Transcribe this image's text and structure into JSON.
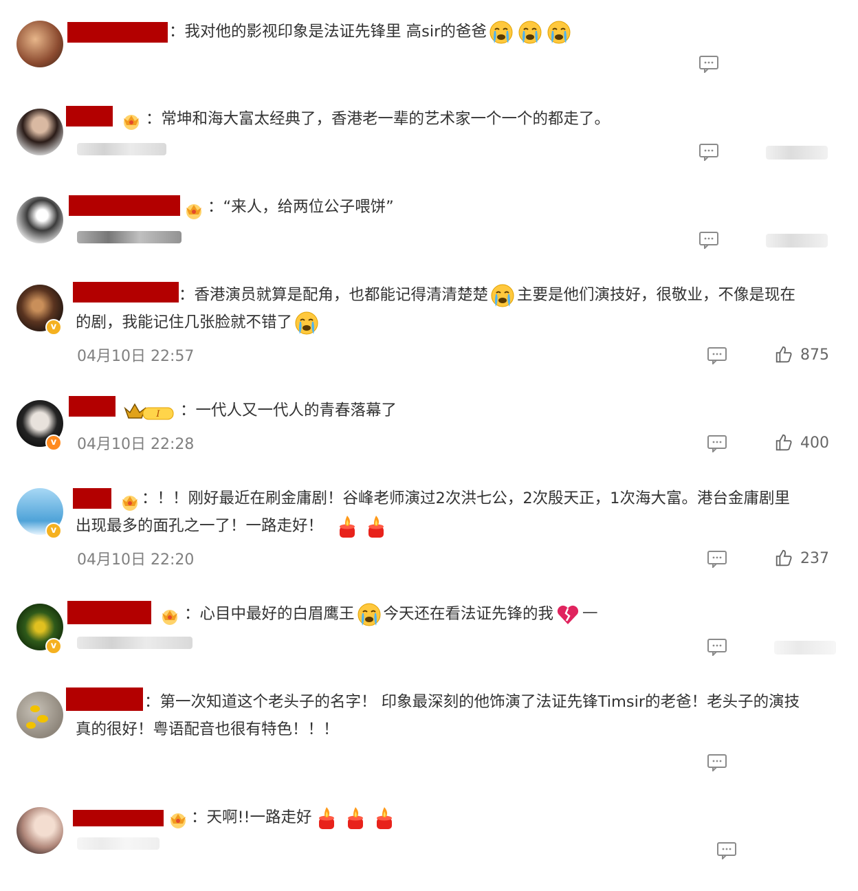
{
  "comments": [
    {
      "text": "：我对他的影视印象是法证先锋里 高sir的爸爸",
      "emojis": 3
    },
    {
      "text": "：常坤和海大富太经典了，香港老一辈的艺术家一个一个的都走了。"
    },
    {
      "text": "：“来人，给两位公子喂饼”"
    },
    {
      "line1": "：香港演员就算是配角，也都能记得清清楚楚",
      "line1b": "主要是他们演技好，很敬业，不像是现在",
      "line2": "的剧，我能记住几张脸就不错了",
      "time": "04月10日 22:57",
      "likes": "875"
    },
    {
      "text": "：一代人又一代人的青春落幕了",
      "time": "04月10日 22:28",
      "likes": "400"
    },
    {
      "line1": "：！！刚好最近在刷金庸剧！谷峰老师演过2次洪七公，2次殷天正，1次海大富。港台金庸剧里",
      "line2": "出现最多的面孔之一了！一路走好！",
      "time": "04月10日 22:20",
      "likes": "237"
    },
    {
      "text": "：心目中最好的白眉鹰王",
      "text_b": "今天还在看法证先锋的我",
      "text_c": "一"
    },
    {
      "line1": "：第一次知道这个老头子的名字！ 印象最深刻的他饰演了法证先锋Timsir的老爸！老头子的演技",
      "line2": "真的很好！粤语配音也很有特色！！！"
    },
    {
      "text": "：天啊!!一路走好"
    }
  ],
  "colors": {
    "redact": "#b30000",
    "text": "#333333",
    "meta": "#808080",
    "badge": "#f5b120"
  },
  "icons": [
    "reply-icon",
    "like-icon",
    "crying-emoji",
    "candle-emoji",
    "broken-heart-emoji",
    "crown-icon",
    "verified-badge"
  ]
}
